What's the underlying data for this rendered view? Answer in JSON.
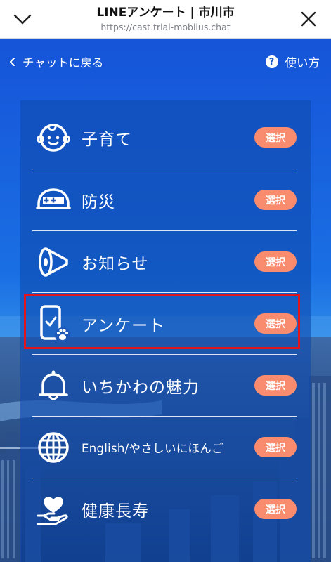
{
  "header": {
    "title": "LINEアンケート | 市川市",
    "url": "https://cast.trial-mobilus.chat",
    "left_icon": "chevron-down-icon",
    "right_icon": "close-icon"
  },
  "nav": {
    "back_label": "チャットに戻る",
    "help_label": "使い方",
    "help_glyph": "?"
  },
  "menu": {
    "items": [
      {
        "label": "子育て",
        "icon": "baby-face-icon",
        "button": "選択"
      },
      {
        "label": "防災",
        "icon": "helmet-icon",
        "button": "選択"
      },
      {
        "label": "お知らせ",
        "icon": "megaphone-icon",
        "button": "選択"
      },
      {
        "label": "アンケート",
        "icon": "phone-check-icon",
        "button": "選択"
      },
      {
        "label": "いちかわの魅力",
        "icon": "bell-icon",
        "button": "選択"
      },
      {
        "label": "English/やさしいにほんご",
        "icon": "globe-icon",
        "button": "選択"
      },
      {
        "label": "健康長寿",
        "icon": "heart-hand-icon",
        "button": "選択"
      }
    ]
  },
  "colors": {
    "select_button": "#f98b6e",
    "highlight_border": "#e0161e",
    "panel": "#0f4baf"
  }
}
